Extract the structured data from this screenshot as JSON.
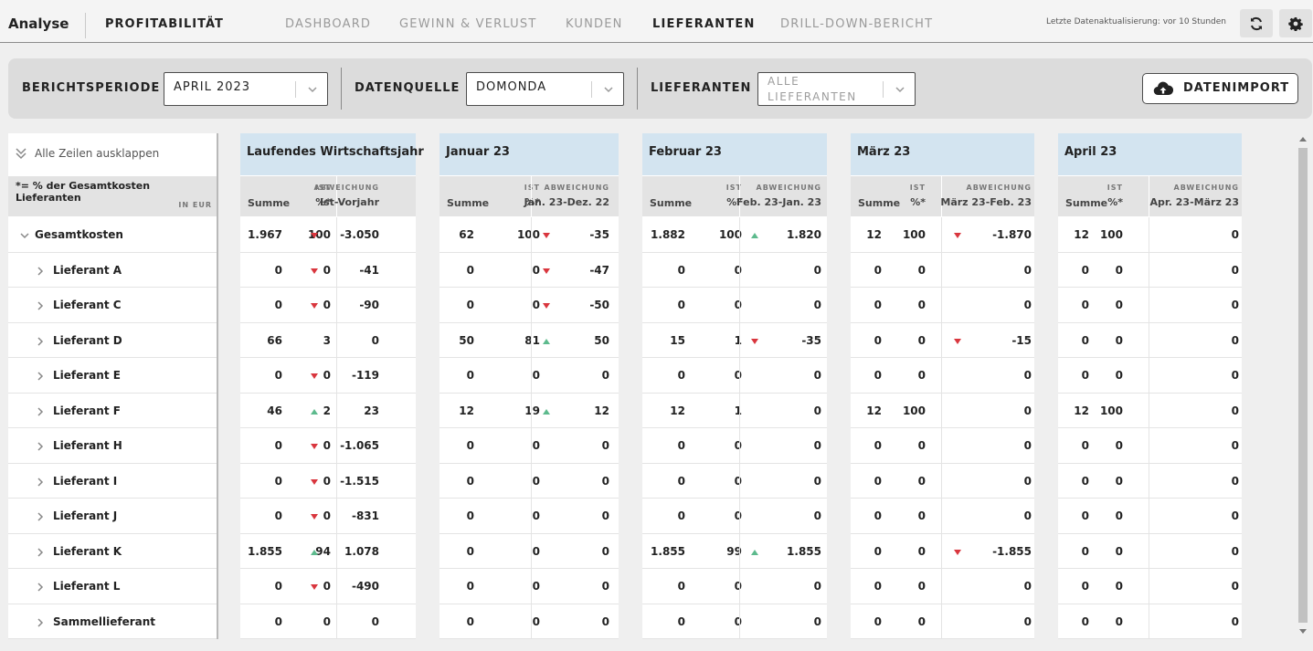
{
  "header": {
    "brand": "Analyse",
    "module": "PROFITABILITÄT",
    "nav": [
      {
        "label": "DASHBOARD",
        "active": false
      },
      {
        "label": "GEWINN & VERLUST",
        "active": false
      },
      {
        "label": "KUNDEN",
        "active": false
      },
      {
        "label": "LIEFERANTEN",
        "active": true
      },
      {
        "label": "DRILL-DOWN-BERICHT",
        "active": false
      }
    ],
    "updated": "Letzte Datenaktualisierung: vor 10 Stunden",
    "refresh_icon": "refresh-icon",
    "settings_icon": "gear-icon"
  },
  "filters": {
    "period_label": "BERICHTSPERIODE",
    "period_value": "APRIL 2023",
    "source_label": "DATENQUELLE",
    "source_value": "DOMONDA",
    "supplier_label": "LIEFERANTEN",
    "supplier_placeholder": "ALLE LIEFERANTEN",
    "import_label": "DATENIMPORT",
    "import_icon": "cloud-upload-icon"
  },
  "table": {
    "expand_all": "Alle Zeilen ausklappen",
    "legend": "*= % der Gesamtkosten Lieferanten",
    "unit": "IN EUR",
    "rows": [
      "Gesamtkosten",
      "Lieferant A",
      "Lieferant C",
      "Lieferant D",
      "Lieferant E",
      "Lieferant F",
      "Lieferant H",
      "Lieferant I",
      "Lieferant J",
      "Lieferant K",
      "Lieferant L",
      "Sammellieferant"
    ],
    "groups": [
      {
        "title": "Laufendes Wirtschaftsjahr",
        "sum_label": "Summe",
        "ist_label": "IST",
        "pct_label": "%*",
        "dev_label": "ABWEICHUNG",
        "dev_period": "Ist-Vorjahr",
        "cells": [
          [
            "1.967",
            "100",
            "down",
            "-3.050"
          ],
          [
            "0",
            "0",
            "down",
            "-41"
          ],
          [
            "0",
            "0",
            "down",
            "-90"
          ],
          [
            "66",
            "3",
            "",
            "0"
          ],
          [
            "0",
            "0",
            "down",
            "-119"
          ],
          [
            "46",
            "2",
            "up",
            "23"
          ],
          [
            "0",
            "0",
            "down",
            "-1.065"
          ],
          [
            "0",
            "0",
            "down",
            "-1.515"
          ],
          [
            "0",
            "0",
            "down",
            "-831"
          ],
          [
            "1.855",
            "94",
            "up",
            "1.078"
          ],
          [
            "0",
            "0",
            "down",
            "-490"
          ],
          [
            "0",
            "0",
            "",
            "0"
          ]
        ]
      },
      {
        "title": "Januar 23",
        "sum_label": "Summe",
        "ist_label": "IST",
        "pct_label": "%*",
        "dev_label": "ABWEICHUNG",
        "dev_period": "Jan. 23-Dez. 22",
        "cells": [
          [
            "62",
            "100",
            "down",
            "-35"
          ],
          [
            "0",
            "0",
            "down",
            "-47"
          ],
          [
            "0",
            "0",
            "down",
            "-50"
          ],
          [
            "50",
            "81",
            "up",
            "50"
          ],
          [
            "0",
            "0",
            "",
            "0"
          ],
          [
            "12",
            "19",
            "up",
            "12"
          ],
          [
            "0",
            "0",
            "",
            "0"
          ],
          [
            "0",
            "0",
            "",
            "0"
          ],
          [
            "0",
            "0",
            "",
            "0"
          ],
          [
            "0",
            "0",
            "",
            "0"
          ],
          [
            "0",
            "0",
            "",
            "0"
          ],
          [
            "0",
            "0",
            "",
            "0"
          ]
        ]
      },
      {
        "title": "Februar 23",
        "sum_label": "Summe",
        "ist_label": "IST",
        "pct_label": "%*",
        "dev_label": "ABWEICHUNG",
        "dev_period": "Feb. 23-Jan. 23",
        "cells": [
          [
            "1.882",
            "100",
            "up",
            "1.820"
          ],
          [
            "0",
            "0",
            "",
            "0"
          ],
          [
            "0",
            "0",
            "",
            "0"
          ],
          [
            "15",
            "1",
            "down",
            "-35"
          ],
          [
            "0",
            "0",
            "",
            "0"
          ],
          [
            "12",
            "1",
            "",
            "0"
          ],
          [
            "0",
            "0",
            "",
            "0"
          ],
          [
            "0",
            "0",
            "",
            "0"
          ],
          [
            "0",
            "0",
            "",
            "0"
          ],
          [
            "1.855",
            "99",
            "up",
            "1.855"
          ],
          [
            "0",
            "0",
            "",
            "0"
          ],
          [
            "0",
            "0",
            "",
            "0"
          ]
        ]
      },
      {
        "title": "März 23",
        "sum_label": "Summe",
        "ist_label": "IST",
        "pct_label": "%*",
        "dev_label": "ABWEICHUNG",
        "dev_period": "März 23-Feb. 23",
        "cells": [
          [
            "12",
            "100",
            "down",
            "-1.870"
          ],
          [
            "0",
            "0",
            "",
            "0"
          ],
          [
            "0",
            "0",
            "",
            "0"
          ],
          [
            "0",
            "0",
            "down",
            "-15"
          ],
          [
            "0",
            "0",
            "",
            "0"
          ],
          [
            "12",
            "100",
            "",
            "0"
          ],
          [
            "0",
            "0",
            "",
            "0"
          ],
          [
            "0",
            "0",
            "",
            "0"
          ],
          [
            "0",
            "0",
            "",
            "0"
          ],
          [
            "0",
            "0",
            "down",
            "-1.855"
          ],
          [
            "0",
            "0",
            "",
            "0"
          ],
          [
            "0",
            "0",
            "",
            "0"
          ]
        ]
      },
      {
        "title": "April 23",
        "sum_label": "Summe",
        "ist_label": "IST",
        "pct_label": "%*",
        "dev_label": "ABWEICHUNG",
        "dev_period": "Apr. 23-März 23",
        "cells": [
          [
            "12",
            "100",
            "",
            "0"
          ],
          [
            "0",
            "0",
            "",
            "0"
          ],
          [
            "0",
            "0",
            "",
            "0"
          ],
          [
            "0",
            "0",
            "",
            "0"
          ],
          [
            "0",
            "0",
            "",
            "0"
          ],
          [
            "12",
            "100",
            "",
            "0"
          ],
          [
            "0",
            "0",
            "",
            "0"
          ],
          [
            "0",
            "0",
            "",
            "0"
          ],
          [
            "0",
            "0",
            "",
            "0"
          ],
          [
            "0",
            "0",
            "",
            "0"
          ],
          [
            "0",
            "0",
            "",
            "0"
          ],
          [
            "0",
            "0",
            "",
            "0"
          ]
        ]
      }
    ]
  }
}
